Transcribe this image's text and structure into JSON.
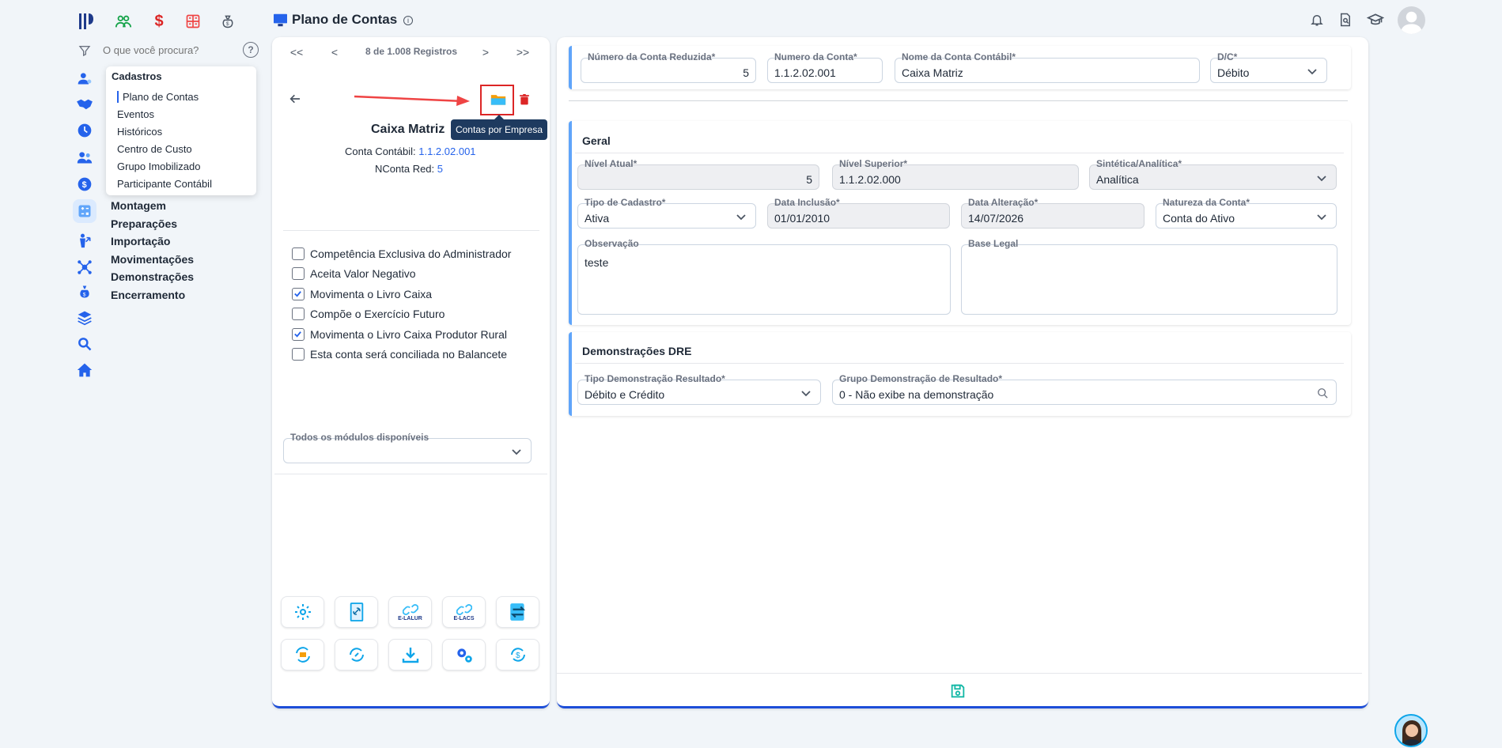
{
  "header": {
    "page_title": "Plano de Contas"
  },
  "search": {
    "placeholder": "O que você procura?"
  },
  "menu": {
    "cadastros": "Cadastros",
    "sub_items": [
      "Plano de Contas",
      "Eventos",
      "Históricos",
      "Centro de Custo",
      "Grupo Imobilizado",
      "Participante Contábil"
    ],
    "sections": [
      "Montagem",
      "Preparações",
      "Importação",
      "Movimentações",
      "Demonstrações",
      "Encerramento"
    ]
  },
  "record_nav": {
    "counter": "8 de 1.008 Registros",
    "first": "<<",
    "prev": "<",
    "next": ">",
    "last": ">>"
  },
  "record": {
    "name": "Caixa Matriz",
    "conta_contabil_label": "Conta Contábil:",
    "conta_contabil_value": "1.1.2.02.001",
    "nconta_label": "NConta Red:",
    "nconta_value": "5",
    "tooltip": "Contas por Empresa"
  },
  "checkboxes": [
    {
      "label": "Competência Exclusiva do Administrador",
      "checked": false
    },
    {
      "label": "Aceita Valor Negativo",
      "checked": false
    },
    {
      "label": "Movimenta o Livro Caixa",
      "checked": true
    },
    {
      "label": "Compõe o Exercício Futuro",
      "checked": false
    },
    {
      "label": "Movimenta o Livro Caixa Produtor Rural",
      "checked": true
    },
    {
      "label": "Esta conta será conciliada no Balancete",
      "checked": false
    }
  ],
  "modules": {
    "label": "Todos os módulos disponíveis",
    "value": ""
  },
  "action_buttons": {
    "elalur": "E-LALUR",
    "elacs": "E-LACS"
  },
  "top_form": {
    "numero_reduzida": {
      "label": "Número da Conta Reduzida*",
      "value": "5"
    },
    "numero_conta": {
      "label": "Numero da Conta*",
      "value": "1.1.2.02.001"
    },
    "nome_conta": {
      "label": "Nome da Conta Contábil*",
      "value": "Caixa Matriz"
    },
    "dc": {
      "label": "D/C*",
      "value": "Débito"
    }
  },
  "geral": {
    "title": "Geral",
    "nivel_atual": {
      "label": "Nível Atual*",
      "value": "5"
    },
    "nivel_superior": {
      "label": "Nível Superior*",
      "value": "1.1.2.02.000"
    },
    "sintetica": {
      "label": "Sintética/Analítica*",
      "value": "Analítica"
    },
    "tipo_cadastro": {
      "label": "Tipo de Cadastro*",
      "value": "Ativa"
    },
    "data_inclusao": {
      "label": "Data Inclusão*",
      "value": "01/01/2010"
    },
    "data_alteracao": {
      "label": "Data Alteração*",
      "value": "14/07/2026"
    },
    "natureza": {
      "label": "Natureza da Conta*",
      "value": "Conta do Ativo"
    },
    "observacao": {
      "label": "Observação",
      "value": "teste"
    },
    "base_legal": {
      "label": "Base Legal",
      "value": ""
    }
  },
  "dre": {
    "title": "Demonstrações DRE",
    "tipo": {
      "label": "Tipo Demonstração Resultado*",
      "value": "Débito e Crédito"
    },
    "grupo": {
      "label": "Grupo Demonstração de Resultado*",
      "value": "0 - Não exibe na demonstração"
    }
  },
  "colors": {
    "accent": "#2563eb",
    "teal": "#14b8a6",
    "red": "#dc2626",
    "bg": "#f1f5f9"
  }
}
